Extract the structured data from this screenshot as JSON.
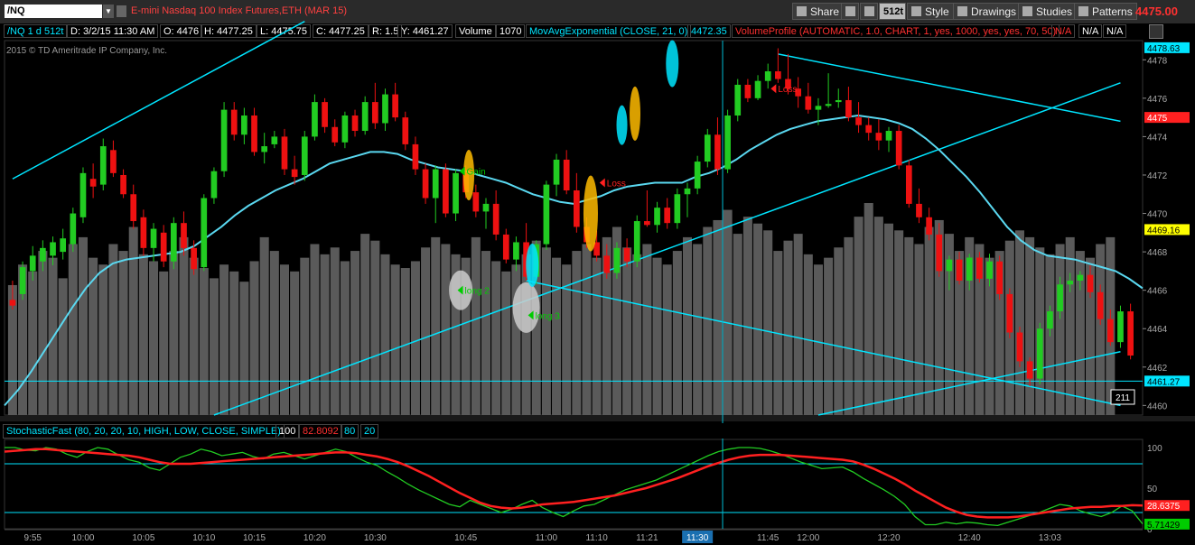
{
  "header": {
    "symbol": "/NQ",
    "description": "E-mini Nasdaq 100 Index Futures,ETH (MAR 15)",
    "buttons": [
      {
        "label": "Share",
        "icon": "share-icon"
      },
      {
        "label": "",
        "icon": "crosshair-icon"
      },
      {
        "label": "",
        "icon": "wrench-icon"
      },
      {
        "label": "512t",
        "icon": "aggregation-icon"
      },
      {
        "label": "Style",
        "icon": "style-icon"
      },
      {
        "label": "Drawings",
        "icon": "pencil-icon"
      },
      {
        "label": "Studies",
        "icon": "studies-icon"
      },
      {
        "label": "Patterns",
        "icon": "patterns-icon"
      }
    ],
    "last_price": "4475.00",
    "accent_color": "#ff3030"
  },
  "infobar": {
    "chart_id": "/NQ 1 d 512t",
    "date": "D: 3/2/15 11:30 AM",
    "open": "O: 4476",
    "high": "H: 4477.25",
    "low": "L: 4475.75",
    "close": "C: 4477.25",
    "range": "R: 1.5",
    "y": "Y: 4461.27",
    "volume_label": "Volume",
    "volume_value": "1070",
    "study1": "MovAvgExponential (CLOSE, 21, 0)",
    "study1_value": "4472.35",
    "study2": "VolumeProfile (AUTOMATIC, 1.0, CHART, 1, yes, 1000, yes, yes, 70, 50)",
    "na1": "N/A",
    "na2": "N/A",
    "na3": "N/A"
  },
  "copyright": "2015 © TD Ameritrade IP Company, Inc.",
  "stoch_header": {
    "label": "StochasticFast (80, 20, 20, 10, HIGH, LOW, CLOSE, SIMPLE)",
    "v1": "100",
    "v2": "82.8092",
    "v3": "80",
    "v4": "20"
  },
  "chart_data": [
    {
      "type": "candlestick",
      "title": "/NQ 1 d 512t",
      "ylim": [
        4459.5,
        4479
      ],
      "y_ticks": [
        4460,
        4462,
        4464,
        4466,
        4468,
        4470,
        4472,
        4474,
        4476,
        4478
      ],
      "price_labels": [
        {
          "value": 4478.63,
          "label": "4478.63",
          "color": "#00e5ff"
        },
        {
          "value": 4475,
          "label": "4475",
          "color": "#ff2020"
        },
        {
          "value": 4469.16,
          "label": "4469.16",
          "color": "#ffff00"
        },
        {
          "value": 4461.27,
          "label": "4461.27",
          "color": "#00e5ff"
        }
      ],
      "x_labels": [
        "9:55",
        "10:00",
        "10:05",
        "10:10",
        "10:15",
        "10:20",
        "10:30",
        "10:45",
        "11:00",
        "11:10",
        "11:21",
        "11:30",
        "11:45",
        "12:00",
        "12:20",
        "12:40",
        "13:03"
      ],
      "x_label_bar_index": [
        2,
        7,
        13,
        19,
        24,
        30,
        36,
        45,
        53,
        58,
        63,
        68,
        75,
        79,
        87,
        95,
        103
      ],
      "highlight_x_label": "11:30",
      "candles": [
        [
          4465.5,
          4466.5,
          4465,
          4465.2
        ],
        [
          4465.8,
          4467.5,
          4465.5,
          4467.2
        ],
        [
          4467,
          4468.3,
          4466.5,
          4467.8
        ],
        [
          4467.5,
          4468.6,
          4467,
          4468.2
        ],
        [
          4467.8,
          4468.8,
          4467.3,
          4468.5
        ],
        [
          4468,
          4469.2,
          4467.6,
          4468.7
        ],
        [
          4468.4,
          4470.3,
          4468,
          4470.0
        ],
        [
          4469.8,
          4472.4,
          4469.5,
          4472.1
        ],
        [
          4471.8,
          4472.6,
          4470.8,
          4471.4
        ],
        [
          4471.5,
          4473.9,
          4471.2,
          4473.5
        ],
        [
          4473.3,
          4473.8,
          4471.9,
          4472.1
        ],
        [
          4472,
          4472.3,
          4470.8,
          4471.0
        ],
        [
          4471,
          4471.5,
          4469.2,
          4469.6
        ],
        [
          4469.8,
          4470.2,
          4467.8,
          4468.2
        ],
        [
          4468.2,
          4469.5,
          4467.5,
          4469.2
        ],
        [
          4469,
          4469.4,
          4467.2,
          4467.5
        ],
        [
          4467.5,
          4469.8,
          4467.1,
          4469.5
        ],
        [
          4469.5,
          4470.1,
          4467.8,
          4468.2
        ],
        [
          4468.2,
          4468.6,
          4466.8,
          4467.1
        ],
        [
          4467.2,
          4471.0,
          4467,
          4470.8
        ],
        [
          4470.8,
          4472.4,
          4470.5,
          4472.2
        ],
        [
          4472.2,
          4475.8,
          4471.9,
          4475.4
        ],
        [
          4475.4,
          4475.8,
          4473.8,
          4474.1
        ],
        [
          4474.1,
          4475.5,
          4473.6,
          4475.1
        ],
        [
          4475.1,
          4475.5,
          4473.0,
          4473.2
        ],
        [
          4473.2,
          4474.2,
          4472.6,
          4473.5
        ],
        [
          4473.6,
          4474.3,
          4473.4,
          4474.0
        ],
        [
          4474.0,
          4474.4,
          4472.0,
          4472.3
        ],
        [
          4472.3,
          4473.0,
          4471.5,
          4471.9
        ],
        [
          4472,
          4474.3,
          4471.7,
          4474.0
        ],
        [
          4474.0,
          4476.2,
          4473.8,
          4475.8
        ],
        [
          4475.8,
          4476.0,
          4474.2,
          4474.5
        ],
        [
          4474.5,
          4474.9,
          4473.5,
          4473.7
        ],
        [
          4473.7,
          4475.3,
          4473.4,
          4475.1
        ],
        [
          4475.1,
          4475.4,
          4474.0,
          4474.3
        ],
        [
          4474.3,
          4476.1,
          4474.1,
          4475.8
        ],
        [
          4475.8,
          4476.8,
          4474.4,
          4474.7
        ],
        [
          4474.7,
          4476.5,
          4474.3,
          4476.2
        ],
        [
          4476.2,
          4476.8,
          4474.8,
          4475.0
        ],
        [
          4475.0,
          4475.3,
          4473.3,
          4473.6
        ],
        [
          4473.6,
          4474.0,
          4472.0,
          4472.3
        ],
        [
          4472.3,
          4472.6,
          4470.5,
          4470.8
        ],
        [
          4470.8,
          4472.5,
          4469.5,
          4472.3
        ],
        [
          4472.3,
          4472.6,
          4469.8,
          4470.0
        ],
        [
          4470.0,
          4472.3,
          4469.6,
          4472.1
        ],
        [
          4472.1,
          4472.5,
          4470.8,
          4471.1
        ],
        [
          4471.1,
          4471.5,
          4469.8,
          4470.1
        ],
        [
          4470.1,
          4470.8,
          4469.2,
          4470.5
        ],
        [
          4470.5,
          4471.2,
          4468.6,
          4468.9
        ],
        [
          4468.9,
          4469.2,
          4467.4,
          4467.6
        ],
        [
          4467.6,
          4468.8,
          4467.0,
          4468.5
        ],
        [
          4468.5,
          4469.5,
          4466.5,
          4466.7
        ],
        [
          4466.7,
          4468.6,
          4466.3,
          4468.4
        ],
        [
          4468.4,
          4471.7,
          4468.1,
          4471.5
        ],
        [
          4471.5,
          4473.1,
          4470.9,
          4472.8
        ],
        [
          4472.8,
          4473.3,
          4471.0,
          4471.2
        ],
        [
          4471.2,
          4472.1,
          4469.0,
          4469.3
        ],
        [
          4469.3,
          4469.8,
          4468.2,
          4468.5
        ],
        [
          4468.5,
          4469.1,
          4467.5,
          4467.8
        ],
        [
          4467.8,
          4468.4,
          4466.6,
          4466.9
        ],
        [
          4466.9,
          4468.5,
          4466.6,
          4468.2
        ],
        [
          4468.2,
          4468.7,
          4467.2,
          4467.5
        ],
        [
          4467.5,
          4469.9,
          4467.2,
          4469.6
        ],
        [
          4469.6,
          4471.2,
          4469.3,
          4469.4
        ],
        [
          4469.4,
          4470.6,
          4469.0,
          4470.3
        ],
        [
          4470.3,
          4470.8,
          4469.2,
          4469.5
        ],
        [
          4469.5,
          4471.3,
          4469.2,
          4471.0
        ],
        [
          4471.0,
          4471.6,
          4469.8,
          4471.3
        ],
        [
          4471.3,
          4473.0,
          4471.0,
          4472.7
        ],
        [
          4472.7,
          4474.4,
          4472.4,
          4474.1
        ],
        [
          4474.1,
          4475.0,
          4472.0,
          4472.3
        ],
        [
          4472.3,
          4475.4,
          4472.1,
          4475.1
        ],
        [
          4475.1,
          4477.0,
          4474.8,
          4476.7
        ],
        [
          4476.7,
          4477.0,
          4475.8,
          4476.0
        ],
        [
          4476.0,
          4477.2,
          4475.9,
          4476.9
        ],
        [
          4476.9,
          4477.8,
          4476.5,
          4477.4
        ],
        [
          4477.4,
          4478.6,
          4476.8,
          4477.0
        ],
        [
          4477.0,
          4478.3,
          4476.2,
          4476.5
        ],
        [
          4476.5,
          4477.1,
          4475.5,
          4476.1
        ],
        [
          4476.1,
          4476.8,
          4475.2,
          4475.4
        ],
        [
          4475.4,
          4476.0,
          4474.6,
          4475.6
        ],
        [
          4475.6,
          4477.3,
          4475.5,
          4475.7
        ],
        [
          4475.8,
          4476.5,
          4475.5,
          4475.9
        ],
        [
          4475.9,
          4476.6,
          4474.8,
          4475.0
        ],
        [
          4475.0,
          4475.8,
          4474.2,
          4474.6
        ],
        [
          4474.6,
          4475.0,
          4473.8,
          4474.2
        ],
        [
          4474.2,
          4474.9,
          4473.3,
          4473.8
        ],
        [
          4473.8,
          4474.5,
          4473.2,
          4474.3
        ],
        [
          4474.3,
          4474.6,
          4472.3,
          4472.5
        ],
        [
          4472.5,
          4472.8,
          4470.3,
          4470.5
        ],
        [
          4470.5,
          4471.3,
          4469.5,
          4469.8
        ],
        [
          4469.8,
          4470.3,
          4468.6,
          4468.9
        ],
        [
          4468.9,
          4469.5,
          4466.7,
          4467.0
        ],
        [
          4467.0,
          4467.8,
          4466.0,
          4467.6
        ],
        [
          4467.6,
          4468.0,
          4466.3,
          4466.5
        ],
        [
          4466.5,
          4467.9,
          4466.0,
          4467.7
        ],
        [
          4467.7,
          4468.0,
          4466.4,
          4466.6
        ],
        [
          4466.6,
          4467.9,
          4466.2,
          4467.5
        ],
        [
          4467.5,
          4467.8,
          4465.5,
          4465.8
        ],
        [
          4465.8,
          4466.1,
          4463.5,
          4463.8
        ],
        [
          4463.8,
          4464.1,
          4462.0,
          4462.3
        ],
        [
          4462.3,
          4462.5,
          4461.0,
          4461.4
        ],
        [
          4461.4,
          4464.3,
          4461.1,
          4464.0
        ],
        [
          4464.0,
          4465.2,
          4463.6,
          4464.9
        ],
        [
          4464.9,
          4466.7,
          4464.5,
          4466.3
        ],
        [
          4466.3,
          4466.9,
          4465.9,
          4466.5
        ],
        [
          4466.5,
          4467.0,
          4466.0,
          4466.8
        ],
        [
          4466.8,
          4467.3,
          4465.6,
          4465.9
        ],
        [
          4465.9,
          4466.3,
          4464.2,
          4464.5
        ],
        [
          4464.5,
          4465.0,
          4463.1,
          4463.3
        ],
        [
          4463.3,
          4465.2,
          4463.0,
          4464.9
        ],
        [
          4464.9,
          4465.3,
          4462.4,
          4462.6
        ]
      ],
      "ema21": [
        4460,
        4460.8,
        4461.8,
        4462.9,
        4464.0,
        4465.1,
        4466.1,
        4466.9,
        4467.4,
        4467.6,
        4467.7,
        4467.8,
        4467.9,
        4468.0,
        4468.3,
        4468.8,
        4469.3,
        4469.9,
        4470.4,
        4470.8,
        4471.2,
        4471.5,
        4471.8,
        4472.2,
        4472.6,
        4472.8,
        4473.0,
        4473.2,
        4473.2,
        4473.1,
        4472.8,
        4472.6,
        4472.4,
        4472.3,
        4472.2,
        4472.0,
        4471.8,
        4471.6,
        4471.3,
        4471.0,
        4470.8,
        4470.6,
        4470.5,
        4470.7,
        4470.9,
        4471.2,
        4471.4,
        4471.5,
        4471.6,
        4471.6,
        4471.6,
        4471.9,
        4472.1,
        4472.4,
        4472.8,
        4473.3,
        4473.7,
        4474.1,
        4474.4,
        4474.6,
        4474.8,
        4474.9,
        4475.0,
        4475.1,
        4475.0,
        4474.9,
        4474.7,
        4474.4,
        4473.9,
        4473.3,
        4472.6,
        4471.9,
        4471.1,
        4470.2,
        4469.3,
        4468.6,
        4468.1,
        4467.8,
        4467.7,
        4467.6,
        4467.4,
        4467.2,
        4467.0,
        4466.6,
        4466.1
      ],
      "annotations": [
        {
          "label": "Gain",
          "bar": 44,
          "price": 4472.2,
          "color": "#00cc00"
        },
        {
          "label": "Loss",
          "bar": 76,
          "price": 4476.5,
          "color": "#ff2020"
        },
        {
          "label": "Loss",
          "bar": 59,
          "price": 4471.6,
          "color": "#ff2020"
        },
        {
          "label": "long 2",
          "bar": 44,
          "price": 4466.0,
          "color": "#00cc00"
        },
        {
          "label": "long 3",
          "bar": 51,
          "price": 4464.7,
          "color": "#00cc00"
        }
      ],
      "volume_badge": "211"
    },
    {
      "type": "line",
      "title": "StochasticFast (80, 20, 20, 10, HIGH, LOW, CLOSE, SIMPLE)",
      "ylim": [
        0,
        110
      ],
      "y_ticks": [
        100,
        50,
        0
      ],
      "levels": [
        80,
        20
      ],
      "value_labels": [
        {
          "value": 28.6375,
          "label": "28.6375",
          "color": "#ff2020"
        },
        {
          "value": 5.71429,
          "label": "5.71429",
          "color": "#00cc00"
        }
      ],
      "series": [
        {
          "name": "FullK",
          "color": "#22cc22",
          "values": [
            100,
            100,
            97,
            96,
            100,
            98,
            92,
            88,
            95,
            100,
            98,
            91,
            85,
            82,
            75,
            72,
            80,
            88,
            92,
            98,
            95,
            90,
            92,
            94,
            89,
            86,
            92,
            94,
            90,
            86,
            90,
            94,
            98,
            95,
            88,
            82,
            78,
            70,
            63,
            55,
            48,
            42,
            36,
            30,
            27,
            35,
            30,
            25,
            20,
            24,
            30,
            35,
            26,
            20,
            15,
            22,
            28,
            30,
            36,
            42,
            48,
            52,
            56,
            60,
            66,
            72,
            78,
            84,
            90,
            95,
            98,
            100,
            100,
            99,
            96,
            92,
            87,
            82,
            78,
            74,
            75,
            76,
            70,
            62,
            55,
            48,
            40,
            30,
            15,
            5,
            5,
            8,
            6,
            8,
            7,
            5,
            4,
            8,
            12,
            16,
            20,
            25,
            30,
            28,
            22,
            18,
            15,
            20,
            28,
            22,
            6
          ]
        },
        {
          "name": "FullD",
          "color": "#ff2020",
          "values": [
            95,
            96,
            97,
            98,
            98,
            97,
            96,
            95,
            94,
            93,
            92,
            91,
            90,
            88,
            85,
            82,
            80,
            80,
            80,
            81,
            82,
            83,
            84,
            85,
            86,
            87,
            88,
            89,
            90,
            91,
            92,
            93,
            94,
            94,
            93,
            91,
            89,
            86,
            82,
            77,
            71,
            65,
            58,
            51,
            44,
            38,
            32,
            28,
            26,
            25,
            26,
            28,
            30,
            31,
            32,
            33,
            35,
            37,
            39,
            41,
            44,
            47,
            50,
            54,
            58,
            62,
            67,
            72,
            77,
            81,
            85,
            88,
            90,
            91,
            91,
            91,
            90,
            89,
            88,
            87,
            86,
            85,
            83,
            79,
            74,
            68,
            62,
            55,
            47,
            40,
            33,
            26,
            21,
            17,
            15,
            14,
            14,
            14,
            15,
            17,
            19,
            21,
            23,
            25,
            26,
            27,
            27,
            28,
            28,
            29,
            28.6
          ]
        }
      ]
    }
  ]
}
